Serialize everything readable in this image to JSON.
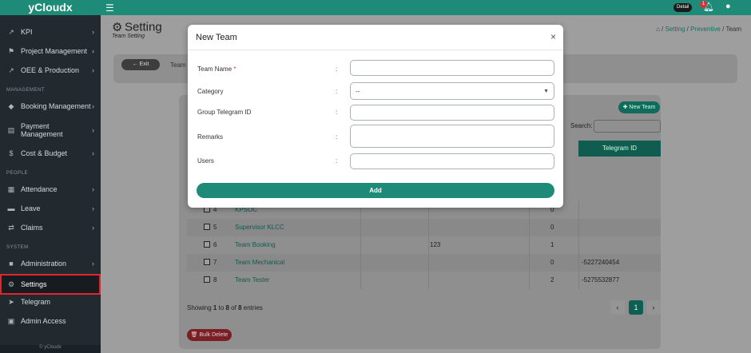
{
  "app": {
    "brand": "yCloudx",
    "footer": "© yCloudx"
  },
  "topbar": {
    "detail_chip": "Detail",
    "notification_count": "1"
  },
  "sidebar": {
    "items": [
      {
        "label": "KPI",
        "chevron": "›"
      },
      {
        "label": "Project Management",
        "chevron": "›"
      },
      {
        "label": "OEE & Production",
        "chevron": "›"
      },
      {
        "label": "Booking Management",
        "chevron": "›"
      },
      {
        "label": "Payment",
        "label2": "Management",
        "chevron": "›"
      },
      {
        "label": "Cost & Budget",
        "chevron": "›"
      },
      {
        "label": "Attendance",
        "chevron": "›"
      },
      {
        "label": "Leave",
        "chevron": "›"
      },
      {
        "label": "Claims",
        "chevron": "›"
      },
      {
        "label": "Administration",
        "chevron": "›"
      },
      {
        "label": "Settings",
        "chevron": ""
      },
      {
        "label": "Telegram",
        "chevron": ""
      },
      {
        "label": "Admin Access",
        "chevron": ""
      }
    ],
    "sections": {
      "management": "MANAGEMENT",
      "people": "PEOPLE",
      "system": "SYSTEM"
    }
  },
  "page": {
    "title": "Setting",
    "subtitle": "Team Setting",
    "breadcrumb": {
      "sep": "/",
      "items": [
        "Setting",
        "Preventive",
        "Team"
      ]
    },
    "exit_label": "Exit",
    "team_label": "Team",
    "new_team_label": "New Team",
    "search_label": "Search:",
    "table": {
      "telegram_header": "Telegram ID",
      "rows": [
        {
          "no": "4",
          "name": "KPSOC",
          "tag": "",
          "users": "0",
          "telegram": ""
        },
        {
          "no": "5",
          "name": "Supervisor KLCC",
          "tag": "",
          "users": "0",
          "telegram": ""
        },
        {
          "no": "6",
          "name": "Team Booking",
          "tag": "123",
          "users": "1",
          "telegram": ""
        },
        {
          "no": "7",
          "name": "Team Mechanical",
          "tag": "",
          "users": "0",
          "telegram": "-5227240454"
        },
        {
          "no": "8",
          "name": "Team Tester",
          "tag": "",
          "users": "2",
          "telegram": "-5275532877"
        }
      ]
    },
    "showing": {
      "pre": "Showing ",
      "from": "1",
      "mid1": " to ",
      "to": "8",
      "mid2": " of ",
      "total": "8",
      "post": " entries"
    },
    "pager": {
      "prev": "‹",
      "current": "1",
      "next": "›"
    },
    "bulk_delete_label": "Bulk Delete"
  },
  "modal": {
    "title": "New Team",
    "close": "×",
    "fields": [
      {
        "label": "Team Name",
        "required": "*",
        "colon": ":",
        "value": ""
      },
      {
        "label": "Category",
        "colon": ":",
        "value": "--"
      },
      {
        "label": "Group Telegram ID",
        "colon": ":",
        "value": ""
      },
      {
        "label": "Remarks",
        "colon": ":",
        "value": ""
      },
      {
        "label": "Users",
        "colon": ":",
        "value": ""
      }
    ],
    "add_label": "Add"
  },
  "colors": {
    "primary": "#1e8a78",
    "sidebar_bg": "#222a30",
    "danger": "#d9323a",
    "highlight": "#e0252c"
  },
  "icons": {
    "kpi": "chart-line-icon",
    "project": "flag-icon",
    "oee": "area-chart-icon",
    "booking": "tag-icon",
    "payment": "cart-icon",
    "cost": "dollar-icon",
    "attendance": "building-icon",
    "leave": "bed-icon",
    "claims": "exchange-icon",
    "admin": "file-icon",
    "settings": "gear-icon",
    "telegram": "telegram-icon",
    "access": "lock-icon"
  }
}
